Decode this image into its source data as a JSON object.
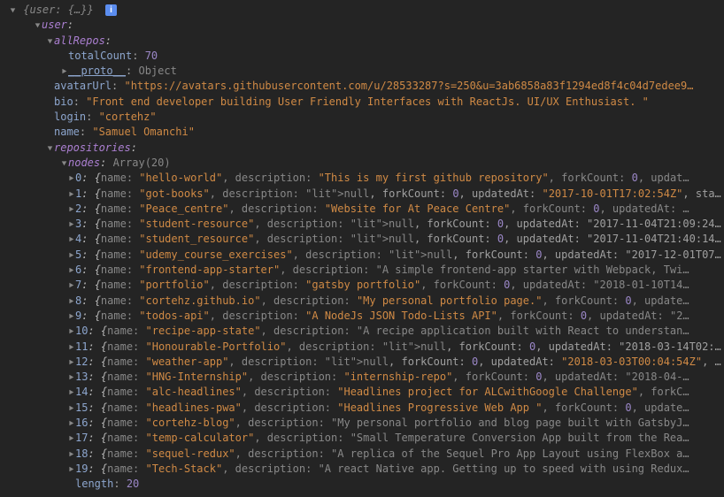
{
  "root_preview": "{user: {…}}",
  "info_badge": "i",
  "user_key": "user",
  "allRepos": {
    "key": "allRepos",
    "totalCount_key": "totalCount",
    "totalCount": 70,
    "proto_key": "__proto__",
    "proto_val": "Object"
  },
  "avatarUrl": {
    "key": "avatarUrl",
    "value": "\"https://avatars.githubusercontent.com/u/28533287?s=250&u=3ab6858a83f1294ed8f4c04d7edee9…"
  },
  "bio": {
    "key": "bio",
    "value": "\"Front end developer building User Friendly Interfaces with ReactJs. UI/UX Enthusiast. \""
  },
  "login": {
    "key": "login",
    "value": "\"cortehz\""
  },
  "name": {
    "key": "name",
    "value": "\"Samuel Omanchi\""
  },
  "repositories_key": "repositories",
  "nodes_key": "nodes",
  "nodes_desc": "Array(20)",
  "length_key": "length",
  "length_val": 20,
  "nodes": [
    {
      "idx": "0",
      "name": "\"hello-world\"",
      "tail": ", description: \"This is my first github repository\", forkCount: 0, updat…"
    },
    {
      "idx": "1",
      "name": "\"got-books\"",
      "tail": ", description: null, forkCount: 0, updatedAt: \"2017-10-01T17:02:54Z\", star…"
    },
    {
      "idx": "2",
      "name": "\"Peace_centre\"",
      "tail": ", description: \"Website for At Peace Centre\", forkCount: 0, updatedAt: …"
    },
    {
      "idx": "3",
      "name": "\"student-resource\"",
      "tail": ", description: null, forkCount: 0, updatedAt: \"2017-11-04T21:09:24Z…"
    },
    {
      "idx": "4",
      "name": "\"student_resource\"",
      "tail": ", description: null, forkCount: 0, updatedAt: \"2017-11-04T21:40:14Z…"
    },
    {
      "idx": "5",
      "name": "\"udemy_course_exercises\"",
      "tail": ", description: null, forkCount: 0, updatedAt: \"2017-12-01T07:…"
    },
    {
      "idx": "6",
      "name": "\"frontend-app-starter\"",
      "tail": ", description: \"A simple frontend-app starter with Webpack, Twi…"
    },
    {
      "idx": "7",
      "name": "\"portfolio\"",
      "tail": ", description: \"gatsby portfolio\", forkCount: 0, updatedAt: \"2018-01-10T14…"
    },
    {
      "idx": "8",
      "name": "\"cortehz.github.io\"",
      "tail": ", description: \"My personal portfolio page.\", forkCount: 0, update…"
    },
    {
      "idx": "9",
      "name": "\"todos-api\"",
      "tail": ", description: \"A NodeJs JSON Todo-Lists API\", forkCount: 0, updatedAt: \"2…"
    },
    {
      "idx": "10",
      "name": "\"recipe-app-state\"",
      "tail": ", description: \"A recipe application built with React to understan…"
    },
    {
      "idx": "11",
      "name": "\"Honourable-Portfolio\"",
      "tail": ", description: null, forkCount: 0, updatedAt: \"2018-03-14T02:0…"
    },
    {
      "idx": "12",
      "name": "\"weather-app\"",
      "tail": ", description: null, forkCount: 0, updatedAt: \"2018-03-03T00:04:54Z\", s…"
    },
    {
      "idx": "13",
      "name": "\"HNG-Internship\"",
      "tail": ", description: \"internship-repo\", forkCount: 0, updatedAt: \"2018-04-…"
    },
    {
      "idx": "14",
      "name": "\"alc-headlines\"",
      "tail": ", description: \"Headlines project for ALCwithGoogle Challenge\", forkC…"
    },
    {
      "idx": "15",
      "name": "\"headlines-pwa\"",
      "tail": ", description: \"Headlines Progressive Web App \", forkCount: 0, update…"
    },
    {
      "idx": "16",
      "name": "\"cortehz-blog\"",
      "tail": ", description: \"My personal portfolio and blog page built with GatsbyJ…"
    },
    {
      "idx": "17",
      "name": "\"temp-calculator\"",
      "tail": ", description: \"Small Temperature Conversion App built from the Rea…"
    },
    {
      "idx": "18",
      "name": "\"sequel-redux\"",
      "tail": ", description: \"A replica of the Sequel Pro App Layout using FlexBox a…"
    },
    {
      "idx": "19",
      "name": "\"Tech-Stack\"",
      "tail": ", description: \"A react Native app. Getting up to speed with using Redux…"
    }
  ]
}
